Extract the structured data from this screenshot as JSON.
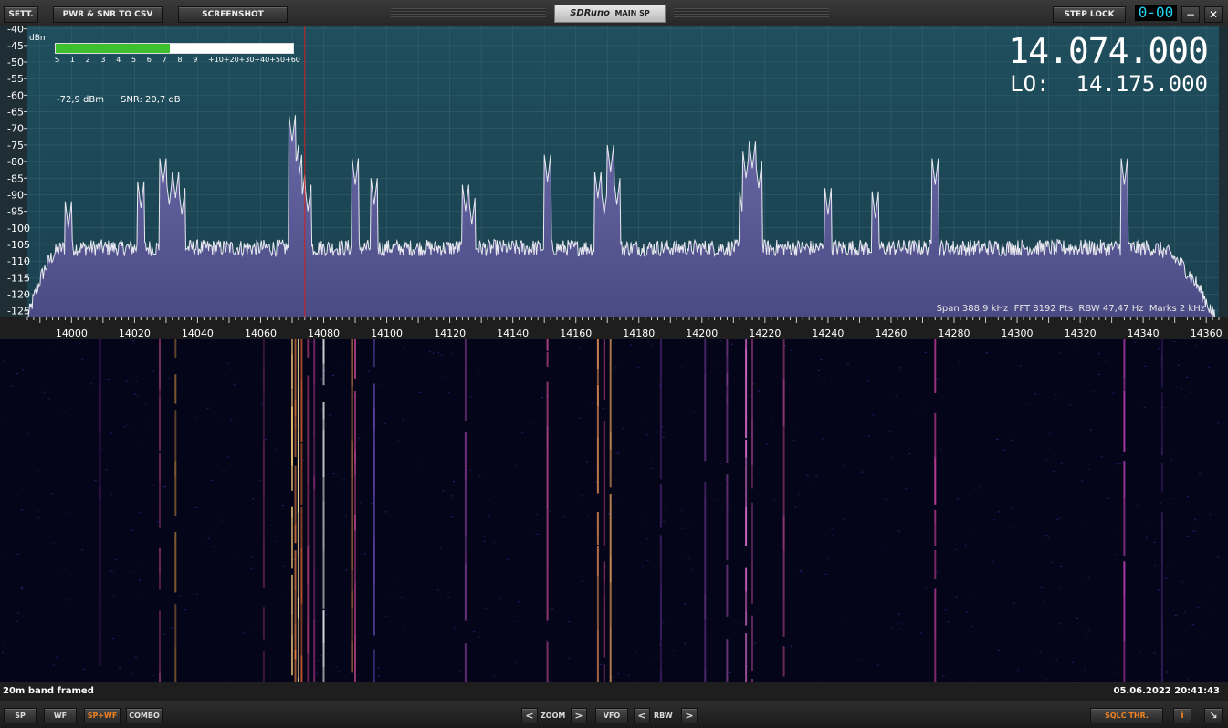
{
  "toolbar": {
    "settings_label": "SETT.",
    "csv_label": "PWR & SNR TO CSV",
    "screenshot_label": "SCREENSHOT",
    "step_lock_label": "STEP LOCK",
    "step_display": "0-00",
    "minimize_label": "−",
    "close_label": "✕"
  },
  "window": {
    "app_name": "SDRuno",
    "title": "MAIN SP"
  },
  "readout": {
    "frequency": "14.074.000",
    "lo_label": "LO:",
    "lo_frequency": "14.175.000",
    "power": "-72,9 dBm",
    "snr": "SNR: 20,7 dB"
  },
  "smeter": {
    "unit": "dBm",
    "scale": [
      "S",
      "1",
      "2",
      "3",
      "4",
      "5",
      "6",
      "7",
      "8",
      "9",
      "+10",
      "+20",
      "+30",
      "+40",
      "+50",
      "+60"
    ],
    "level_fraction": 0.48
  },
  "spectrum_info": "Span 388,9 kHz  FFT 8192 Pts  RBW 47,47 Hz  Marks 2 kHz",
  "chart_data": {
    "type": "line",
    "xlim": [
      13986,
      14364
    ],
    "ylim": [
      -127,
      -39
    ],
    "x_ticks": [
      14000,
      14020,
      14040,
      14060,
      14080,
      14100,
      14120,
      14140,
      14160,
      14180,
      14200,
      14220,
      14240,
      14260,
      14280,
      14300,
      14320,
      14340,
      14360
    ],
    "y_ticks": [
      -40,
      -45,
      -50,
      -55,
      -60,
      -65,
      -70,
      -75,
      -80,
      -85,
      -90,
      -95,
      -100,
      -105,
      -110,
      -115,
      -120,
      -125
    ],
    "tuned_frequency": 14074,
    "noise_floor": -106,
    "peaks": [
      {
        "x": 13999,
        "y": -100
      },
      {
        "x": 14022,
        "y": -94
      },
      {
        "x": 14029,
        "y": -87
      },
      {
        "x": 14031,
        "y": -93
      },
      {
        "x": 14033,
        "y": -91
      },
      {
        "x": 14035,
        "y": -96
      },
      {
        "x": 14070,
        "y": -74
      },
      {
        "x": 14071,
        "y": -83
      },
      {
        "x": 14072,
        "y": -86
      },
      {
        "x": 14073,
        "y": -92
      },
      {
        "x": 14075,
        "y": -95
      },
      {
        "x": 14090,
        "y": -87
      },
      {
        "x": 14096,
        "y": -93
      },
      {
        "x": 14125,
        "y": -95
      },
      {
        "x": 14127,
        "y": -99
      },
      {
        "x": 14151,
        "y": -86
      },
      {
        "x": 14167,
        "y": -91
      },
      {
        "x": 14169,
        "y": -96
      },
      {
        "x": 14171,
        "y": -83
      },
      {
        "x": 14173,
        "y": -93
      },
      {
        "x": 14214,
        "y": -85
      },
      {
        "x": 14216,
        "y": -82
      },
      {
        "x": 14218,
        "y": -88
      },
      {
        "x": 14213,
        "y": -97
      },
      {
        "x": 14240,
        "y": -96
      },
      {
        "x": 14255,
        "y": -97
      },
      {
        "x": 14274,
        "y": -87
      },
      {
        "x": 14334,
        "y": -87
      }
    ],
    "waterfall_tracks": [
      {
        "f": 14009,
        "c": "#9d2fb8",
        "o": 0.5
      },
      {
        "f": 14028,
        "c": "#c4458e",
        "o": 0.6
      },
      {
        "f": 14033,
        "c": "#ffb347",
        "o": 0.5
      },
      {
        "f": 14061,
        "c": "#c4458e",
        "o": 0.4
      },
      {
        "f": 14070,
        "c": "#ffd27a",
        "o": 0.9
      },
      {
        "f": 14071,
        "c": "#ff8c42",
        "o": 0.9
      },
      {
        "f": 14072,
        "c": "#ffe8a0",
        "o": 0.95
      },
      {
        "f": 14073,
        "c": "#e8662f",
        "o": 0.8
      },
      {
        "f": 14075,
        "c": "#d84a8c",
        "o": 0.7
      },
      {
        "f": 14077,
        "c": "#b83a9c",
        "o": 0.6
      },
      {
        "f": 14080,
        "c": "#ffffff",
        "o": 0.85
      },
      {
        "f": 14089,
        "c": "#ff9a4a",
        "o": 0.9
      },
      {
        "f": 14090,
        "c": "#c4458e",
        "o": 0.8
      },
      {
        "f": 14096,
        "c": "#7e5ce0",
        "o": 0.7
      },
      {
        "f": 14125,
        "c": "#b04fc0",
        "o": 0.6
      },
      {
        "f": 14151,
        "c": "#d0509c",
        "o": 0.9
      },
      {
        "f": 14167,
        "c": "#ff9f5a",
        "o": 0.8
      },
      {
        "f": 14169,
        "c": "#d84a8c",
        "o": 0.7
      },
      {
        "f": 14171,
        "c": "#ffb060",
        "o": 0.8
      },
      {
        "f": 14187,
        "c": "#7a3cb0",
        "o": 0.5
      },
      {
        "f": 14201,
        "c": "#a050d0",
        "o": 0.5
      },
      {
        "f": 14208,
        "c": "#c060d0",
        "o": 0.6
      },
      {
        "f": 14214,
        "c": "#e070d0",
        "o": 0.9
      },
      {
        "f": 14216,
        "c": "#c04fa0",
        "o": 0.6
      },
      {
        "f": 14226,
        "c": "#d0509c",
        "o": 0.7
      },
      {
        "f": 14274,
        "c": "#d040a0",
        "o": 0.9
      },
      {
        "f": 14334,
        "c": "#c040b8",
        "o": 0.9
      },
      {
        "f": 14346,
        "c": "#7a3cb0",
        "o": 0.4
      }
    ]
  },
  "waterfall": {
    "label": "20m band framed",
    "timestamp": "05.06.2022 20:41:43"
  },
  "bottom": {
    "sp_label": "SP",
    "wf_label": "WF",
    "spwf_label": "SP+WF",
    "combo_label": "COMBO",
    "zoom_label": "ZOOM",
    "vfo_label": "VFO",
    "rbw_label": "RBW",
    "left_arrow": "<",
    "right_arrow": ">",
    "sqlc_label": "SQLC THR.",
    "info_label": "i",
    "resize_label": "↘"
  },
  "colors": {
    "spectrum_bg": "#1d4a58",
    "spectrum_fill": "#5c5c96",
    "trace": "#e8e8f0",
    "tuned_line": "#d02020",
    "smeter_bar": "#3fbf2f",
    "readout": "#ffffff",
    "step_display": "#22d3f0",
    "accent": "#f08020"
  }
}
